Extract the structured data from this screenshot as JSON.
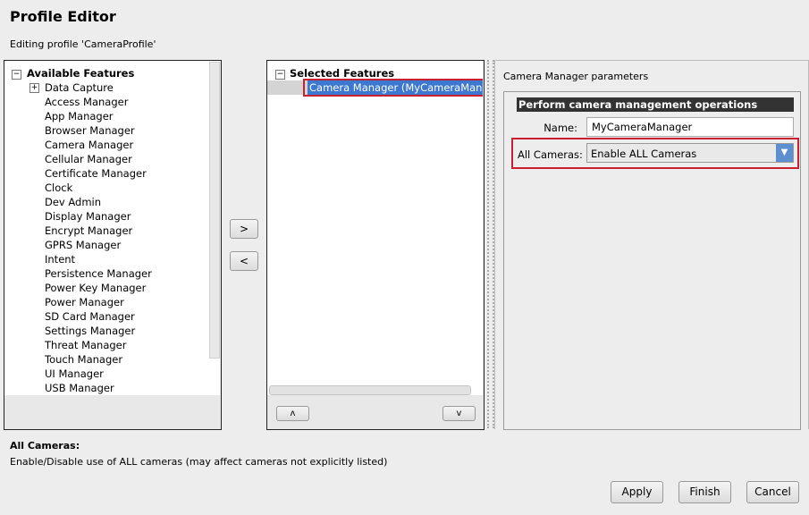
{
  "title": "Profile Editor",
  "subtitle": "Editing profile 'CameraProfile'",
  "available": {
    "header": "Available Features",
    "items": [
      "Data Capture",
      "Access Manager",
      "App Manager",
      "Browser Manager",
      "Camera Manager",
      "Cellular Manager",
      "Certificate Manager",
      "Clock",
      "Dev Admin",
      "Display Manager",
      "Encrypt Manager",
      "GPRS Manager",
      "Intent",
      "Persistence Manager",
      "Power Key Manager",
      "Power Manager",
      "SD Card Manager",
      "Settings Manager",
      "Threat Manager",
      "Touch Manager",
      "UI Manager",
      "USB Manager"
    ]
  },
  "move": {
    "add": ">",
    "remove": "<"
  },
  "selected": {
    "header": "Selected Features",
    "items": [
      "Camera Manager (MyCameraManager)"
    ],
    "up": "ʌ",
    "down": "v"
  },
  "params": {
    "title": "Camera Manager parameters",
    "group_header": "Perform camera management operations",
    "name_label": "Name:",
    "name_value": "MyCameraManager",
    "cameras_label": "All Cameras:",
    "cameras_value": "Enable ALL Cameras"
  },
  "help": {
    "title": "All Cameras:",
    "text": "Enable/Disable use of ALL cameras (may affect cameras not explicitly listed)"
  },
  "buttons": {
    "apply": "Apply",
    "finish": "Finish",
    "cancel": "Cancel"
  },
  "colors": {
    "highlight": "#3c78d0",
    "annotation": "#c8202e",
    "header_bar": "#333333"
  }
}
